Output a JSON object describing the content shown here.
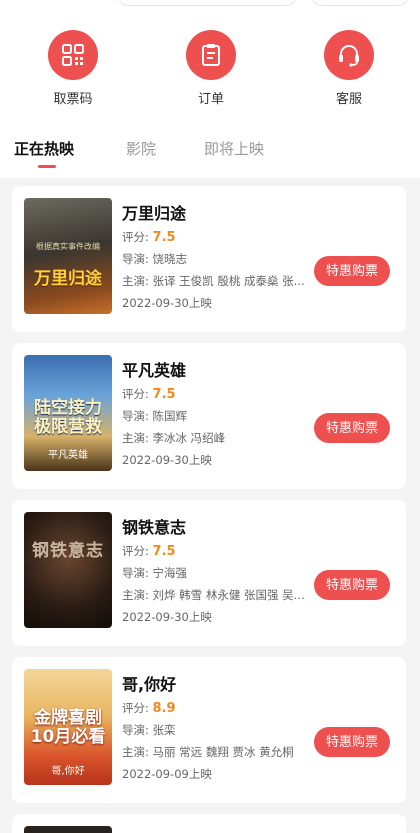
{
  "quick_actions": [
    {
      "label": "取票码",
      "icon": "qr-code-icon"
    },
    {
      "label": "订单",
      "icon": "clipboard-icon"
    },
    {
      "label": "客服",
      "icon": "headset-icon"
    }
  ],
  "tabs": [
    {
      "label": "正在热映",
      "active": true
    },
    {
      "label": "影院",
      "active": false
    },
    {
      "label": "即将上映",
      "active": false
    }
  ],
  "movies": [
    {
      "title": "万里归途",
      "score_label": "评分:",
      "score": "7.5",
      "director": "导演: 饶晓志",
      "cast": "主演: 张译 王俊凯 殷桃 成泰燊 张...",
      "release": "2022-09-30上映",
      "buy_label": "特惠购票",
      "poster_text": "万里归途",
      "poster_subtext": "根据真实事件改编"
    },
    {
      "title": "平凡英雄",
      "score_label": "评分:",
      "score": "7.5",
      "director": "导演: 陈国辉",
      "cast": "主演: 李冰冰 冯绍峰",
      "release": "2022-09-30上映",
      "buy_label": "特惠购票",
      "poster_text": "陆空接力 极限营救",
      "poster_subtext": "平凡英雄"
    },
    {
      "title": "钢铁意志",
      "score_label": "评分:",
      "score": "7.5",
      "director": "导演: 宁海强",
      "cast": "主演: 刘烨 韩雪 林永健 张国强 吴...",
      "release": "2022-09-30上映",
      "buy_label": "特惠购票",
      "poster_text": "钢铁意志",
      "poster_subtext": ""
    },
    {
      "title": "哥,你好",
      "score_label": "评分:",
      "score": "8.9",
      "director": "导演: 张栾",
      "cast": "主演: 马丽 常远 魏翔 贾冰 黄允桐",
      "release": "2022-09-09上映",
      "buy_label": "特惠购票",
      "poster_text": "金牌喜剧 10月必看",
      "poster_subtext": "哥,你好"
    }
  ],
  "colors": {
    "accent": "#ee4f4f",
    "score": "#f28a1c"
  }
}
